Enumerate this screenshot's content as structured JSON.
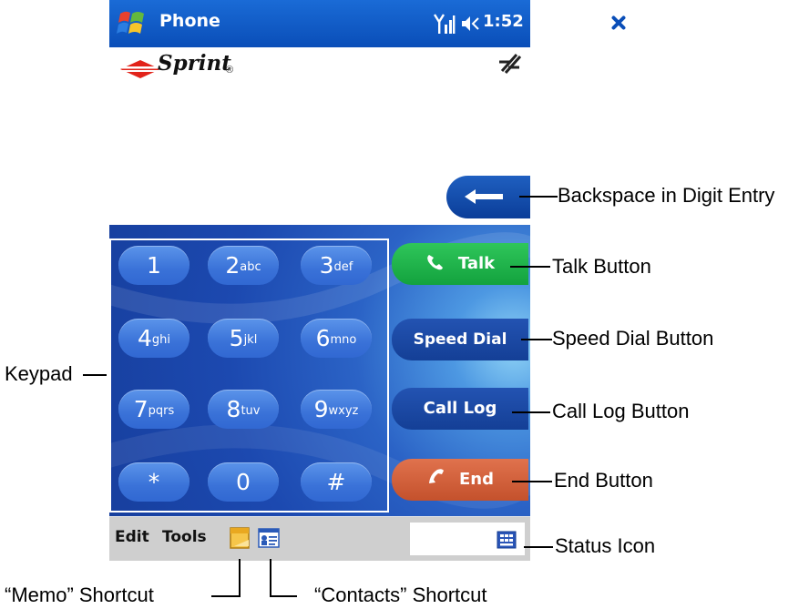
{
  "titlebar": {
    "title": "Phone",
    "time": "1:52"
  },
  "carrier": {
    "name": "Sprint"
  },
  "keypad": {
    "keys": [
      {
        "digit": "1",
        "letters": ""
      },
      {
        "digit": "2",
        "letters": "abc"
      },
      {
        "digit": "3",
        "letters": "def"
      },
      {
        "digit": "4",
        "letters": "ghi"
      },
      {
        "digit": "5",
        "letters": "jkl"
      },
      {
        "digit": "6",
        "letters": "mno"
      },
      {
        "digit": "7",
        "letters": "pqrs"
      },
      {
        "digit": "8",
        "letters": "tuv"
      },
      {
        "digit": "9",
        "letters": "wxyz"
      },
      {
        "digit": "*",
        "letters": ""
      },
      {
        "digit": "0",
        "letters": ""
      },
      {
        "digit": "#",
        "letters": ""
      }
    ]
  },
  "buttons": {
    "talk": "Talk",
    "speed_dial": "Speed Dial",
    "call_log": "Call Log",
    "end": "End"
  },
  "menubar": {
    "edit": "Edit",
    "tools": "Tools"
  },
  "callouts": {
    "backspace": "Backspace in Digit Entry",
    "talk": "Talk Button",
    "speed_dial": "Speed Dial Button",
    "keypad": "Keypad",
    "call_log": "Call Log Button",
    "end": "End Button",
    "status": "Status Icon",
    "memo": "“Memo” Shortcut",
    "contacts": "“Contacts” Shortcut"
  },
  "colors": {
    "titlebar": "#0a4eb8",
    "talk": "#13a23e",
    "end": "#c4512c",
    "panel": "#1c49b0",
    "menubar": "#cfcfcf"
  },
  "icons": {
    "start": "windows-flag-icon",
    "signal": "signal-strength-icon",
    "volume": "volume-icon",
    "close": "close-icon",
    "data": "data-connection-icon",
    "backspace": "backspace-arrow-icon",
    "talk": "phone-handset-icon",
    "end": "hang-up-icon",
    "memo": "memo-icon",
    "contacts": "contacts-icon",
    "status": "status-icon"
  }
}
